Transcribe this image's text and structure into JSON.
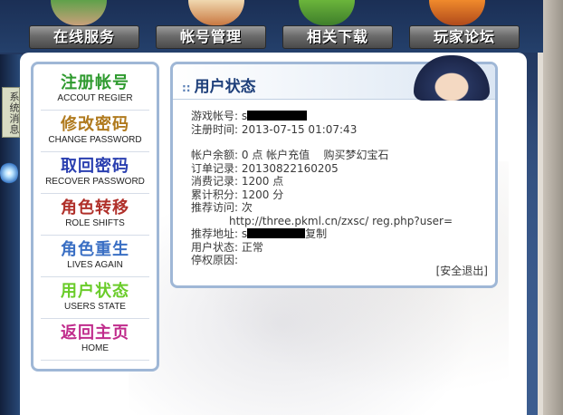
{
  "nav": [
    {
      "label": "在线服务"
    },
    {
      "label": "帐号管理"
    },
    {
      "label": "相关下载"
    },
    {
      "label": "玩家论坛"
    }
  ],
  "side_tab": "系统消息",
  "menu": [
    {
      "cn": "注册帐号",
      "en": "ACCOUT REGIER",
      "color": "#2e9a2e"
    },
    {
      "cn": "修改密码",
      "en": "CHANGE PASSWORD",
      "color": "#b07a1e"
    },
    {
      "cn": "取回密码",
      "en": "RECOVER PASSWORD",
      "color": "#2a3fb0"
    },
    {
      "cn": "角色转移",
      "en": "ROLE SHIFTS",
      "color": "#b0302a"
    },
    {
      "cn": "角色重生",
      "en": "LIVES AGAIN",
      "color": "#3a6fc4"
    },
    {
      "cn": "用户状态",
      "en": "USERS STATE",
      "color": "#6acc2a"
    },
    {
      "cn": "返回主页",
      "en": "HOME",
      "color": "#c02c8c"
    }
  ],
  "status": {
    "title": "用户状态",
    "account_label": "游戏帐号:",
    "account_value": "s",
    "reg_label": "注册时间:",
    "reg_value": "2013-07-15 01:07:43",
    "balance_label": "帐户余额:",
    "balance_value": "0 点",
    "recharge_link": "帐户充值",
    "buy_link": "购买梦幻宝石",
    "order_label": "订单记录:",
    "order_value": "20130822160205",
    "consume_label": "消费记录:",
    "consume_value": "1200 点",
    "points_label": "累计积分:",
    "points_value": "1200 分",
    "visits_label": "推荐访问:",
    "visits_value": "次",
    "rec_label": "推荐地址:",
    "rec_url": "http://three.pkml.cn/zxsc/ reg.php?user=",
    "rec_prefix": "s",
    "copy_label": "复制",
    "state_label": "用户状态:",
    "state_value": "正常",
    "reason_label": "停权原因:",
    "reason_value": "",
    "logout": "[安全退出]"
  }
}
